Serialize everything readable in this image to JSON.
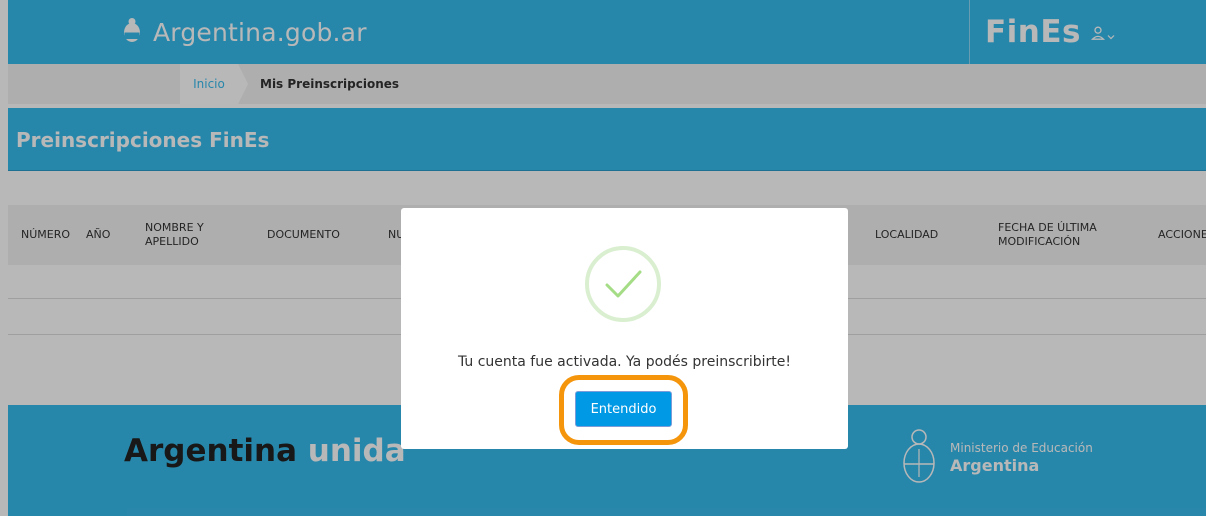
{
  "header": {
    "brand": "Argentina.gob.ar",
    "app_name": "FinEs"
  },
  "breadcrumb": {
    "home": "Inicio",
    "current": "Mis Preinscripciones"
  },
  "page_title": "Preinscripciones FinEs",
  "table": {
    "columns": [
      "NÚMERO",
      "AÑO",
      "NOMBRE Y APELLIDO",
      "DOCUMENTO",
      "NU",
      "LOCALIDAD",
      "FECHA DE ÚLTIMA MODIFICACIÓN",
      "ACCIONES"
    ]
  },
  "footer": {
    "slogan_main": "Argentina",
    "slogan_accent": "unida",
    "ministry_name": "Ministerio de Educación",
    "ministry_country": "Argentina"
  },
  "modal": {
    "message": "Tu cuenta fue activada. Ya podés preinscribirte!",
    "button_label": "Entendido"
  },
  "colors": {
    "primary": "#37bbed",
    "button": "#0099e5",
    "success": "#a5dc86",
    "highlight": "#f4950c"
  }
}
